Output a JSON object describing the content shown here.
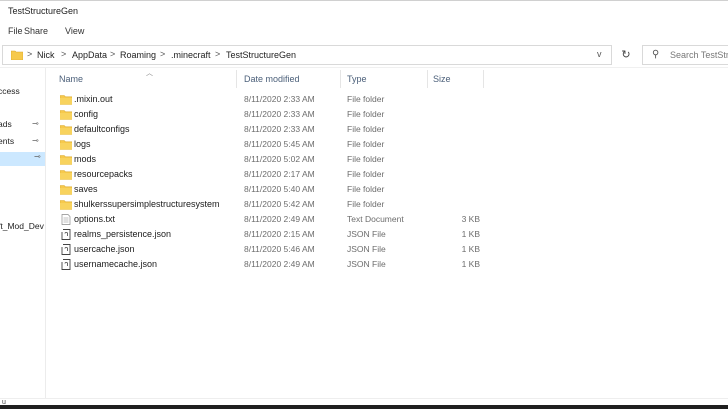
{
  "window": {
    "title": "TestStructureGen"
  },
  "ribbon": {
    "tabs": [
      "File",
      "Share",
      "View"
    ]
  },
  "address": {
    "crumbs": [
      "Nick",
      "AppData",
      "Roaming",
      ".minecraft",
      "TestStructureGen"
    ],
    "separator": ">",
    "dropdown": "v",
    "refresh": "↻",
    "search_placeholder": "Search TestStru"
  },
  "navpane": {
    "items": [
      {
        "label": "ccess",
        "pinned": false,
        "selected": false
      },
      {
        "label": "ads",
        "pinned": true,
        "selected": false
      },
      {
        "label": "ents",
        "pinned": true,
        "selected": false
      },
      {
        "label": "",
        "pinned": true,
        "selected": true
      },
      {
        "label": "ft_Mod_Dev",
        "pinned": false,
        "selected": false
      }
    ],
    "pin_glyph": "📌"
  },
  "columns": {
    "name": "Name",
    "date": "Date modified",
    "type": "Type",
    "size": "Size"
  },
  "files": [
    {
      "name": ".mixin.out",
      "date": "8/11/2020 2:33 AM",
      "type": "File folder",
      "size": "",
      "icon": "folder-icon"
    },
    {
      "name": "config",
      "date": "8/11/2020 2:33 AM",
      "type": "File folder",
      "size": "",
      "icon": "folder-icon"
    },
    {
      "name": "defaultconfigs",
      "date": "8/11/2020 2:33 AM",
      "type": "File folder",
      "size": "",
      "icon": "folder-icon"
    },
    {
      "name": "logs",
      "date": "8/11/2020 5:45 AM",
      "type": "File folder",
      "size": "",
      "icon": "folder-icon"
    },
    {
      "name": "mods",
      "date": "8/11/2020 5:02 AM",
      "type": "File folder",
      "size": "",
      "icon": "folder-icon"
    },
    {
      "name": "resourcepacks",
      "date": "8/11/2020 2:17 AM",
      "type": "File folder",
      "size": "",
      "icon": "folder-icon"
    },
    {
      "name": "saves",
      "date": "8/11/2020 5:40 AM",
      "type": "File folder",
      "size": "",
      "icon": "folder-icon"
    },
    {
      "name": "shulkerssupersimplestructuresystem",
      "date": "8/11/2020 5:42 AM",
      "type": "File folder",
      "size": "",
      "icon": "folder-icon"
    },
    {
      "name": "options.txt",
      "date": "8/11/2020 2:49 AM",
      "type": "Text Document",
      "size": "3 KB",
      "icon": "text-file-icon"
    },
    {
      "name": "realms_persistence.json",
      "date": "8/11/2020 2:15 AM",
      "type": "JSON File",
      "size": "1 KB",
      "icon": "json-file-icon"
    },
    {
      "name": "usercache.json",
      "date": "8/11/2020 5:46 AM",
      "type": "JSON File",
      "size": "1 KB",
      "icon": "json-file-icon"
    },
    {
      "name": "usernamecache.json",
      "date": "8/11/2020 2:49 AM",
      "type": "JSON File",
      "size": "1 KB",
      "icon": "json-file-icon"
    }
  ],
  "status": {
    "text": "u"
  },
  "colors": {
    "folder": "#f6c94c",
    "selection": "#cce8ff",
    "header_text": "#4c607a"
  }
}
